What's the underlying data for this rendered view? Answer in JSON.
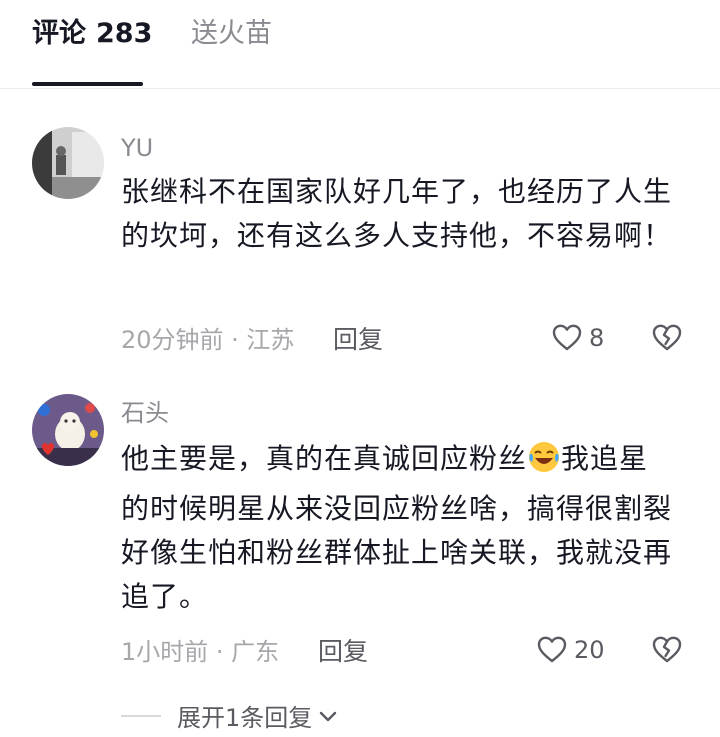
{
  "tabs": {
    "comments_label": "评论",
    "comments_count": "283",
    "gift_label": "送火苗"
  },
  "comments": [
    {
      "username": "YU",
      "text": "张继科不在国家队好几年了，也经历了人生的坎坷，还有这么多人支持他，不容易啊！",
      "meta": "20分钟前 · 江苏",
      "reply_label": "回复",
      "likes": "8"
    },
    {
      "username": "石头",
      "text_before_emoji": "他主要是，真的在真诚回应粉丝",
      "emoji": "laughing-crying-emoji",
      "text_after_emoji": "我追星的时候明星从来没回应粉丝啥，搞得很割裂好像生怕和粉丝群体扯上啥关联，我就没再追了。",
      "meta": "1小时前 · 广东",
      "reply_label": "回复",
      "likes": "20",
      "expand_label": "展开1条回复"
    }
  ],
  "colors": {
    "primary_text": "#161823",
    "secondary_text": "#8a8b91",
    "meta_text": "#a6a7ab"
  }
}
